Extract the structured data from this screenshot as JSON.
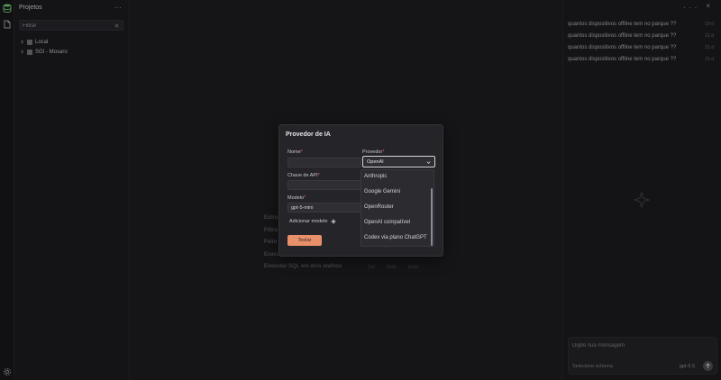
{
  "sidebar": {
    "title": "Projetos",
    "more": "...",
    "filter_placeholder": "Filtrar",
    "tree": [
      {
        "label": "Local"
      },
      {
        "label": "SGI - Mosaro"
      }
    ]
  },
  "background_content": {
    "rows": [
      {
        "label": "Estru"
      },
      {
        "label": "Filtra"
      },
      {
        "label": "Feito"
      },
      {
        "label": "Execu"
      },
      {
        "label": "Executar SQL em dois atalhos",
        "shortcuts": [
          "Ctrl",
          "Shift",
          "Enter"
        ]
      }
    ]
  },
  "right_panel": {
    "icons": "... ×",
    "history": [
      {
        "text": "quantos dispositivos offline tem no parque ??",
        "meta": "19 d"
      },
      {
        "text": "quantos dispositivos offline tem no parque ??",
        "meta": "21 d"
      },
      {
        "text": "quantos dispositivos offline tem no parque ??",
        "meta": "21 d"
      },
      {
        "text": "quantos dispositivos offline tem no parque ??",
        "meta": "21 d"
      }
    ],
    "composer": {
      "placeholder": "Digite sua mensagem",
      "schema": "Selecione schema",
      "model": "gpt-5.5"
    }
  },
  "modal": {
    "title": "Provedor de IA",
    "name_label": "Nome",
    "provider_label": "Provedor",
    "required_mark": "*",
    "provider_value": "OpenAI",
    "api_key_label": "Chave de API",
    "model_label": "Modelo",
    "model_value": "gpt-5-mini",
    "add_model": "Adicionar modelo",
    "test_button": "Testar",
    "provider_options": [
      "Anthropic",
      "Google Gemini",
      "OpenRouter",
      "OpenAI compatível",
      "Codex via plano ChatGPT"
    ]
  },
  "colors": {
    "accent": "#e8906a",
    "required": "#e06c5a",
    "background": "#1b1b1e"
  }
}
